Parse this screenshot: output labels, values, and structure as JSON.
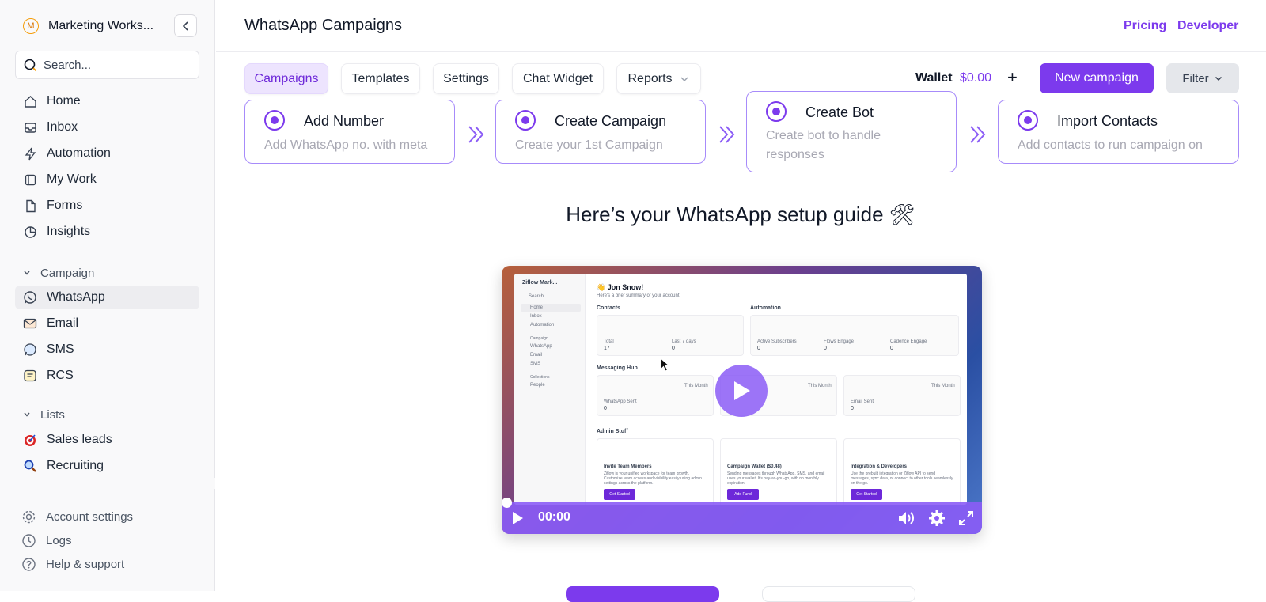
{
  "sidebar": {
    "workspace": {
      "initial": "M",
      "name": "Marketing Works..."
    },
    "search_placeholder": "Search...",
    "nav": [
      {
        "label": "Home",
        "icon": "home-icon"
      },
      {
        "label": "Inbox",
        "icon": "inbox-icon"
      },
      {
        "label": "Automation",
        "icon": "lightning-icon"
      },
      {
        "label": "My Work",
        "icon": "board-icon"
      },
      {
        "label": "Forms",
        "icon": "document-icon"
      },
      {
        "label": "Insights",
        "icon": "pie-chart-icon"
      }
    ],
    "campaign_section": "Campaign",
    "campaign_items": [
      {
        "label": "WhatsApp",
        "icon": "whatsapp-icon",
        "active": true
      },
      {
        "label": "Email",
        "icon": "email-icon"
      },
      {
        "label": "SMS",
        "icon": "sms-icon"
      },
      {
        "label": "RCS",
        "icon": "rcs-icon"
      }
    ],
    "lists_section": "Lists",
    "list_items": [
      {
        "label": "Sales leads",
        "icon": "target-icon"
      },
      {
        "label": "Recruiting",
        "icon": "magnifier-icon"
      }
    ],
    "bottom": [
      {
        "label": "Account settings",
        "icon": "gear-icon"
      },
      {
        "label": "Logs",
        "icon": "clock-icon"
      },
      {
        "label": "Help & support",
        "icon": "help-icon"
      }
    ]
  },
  "header": {
    "title": "WhatsApp Campaigns",
    "pricing": "Pricing",
    "developer": "Developer"
  },
  "tabs": [
    {
      "label": "Campaigns",
      "active": true
    },
    {
      "label": "Templates"
    },
    {
      "label": "Settings"
    },
    {
      "label": "Chat Widget"
    },
    {
      "label": "Reports"
    }
  ],
  "wallet": {
    "label": "Wallet",
    "amount": "$0.00",
    "add": "+"
  },
  "actions": {
    "new_campaign": "New campaign",
    "filter": "Filter"
  },
  "steps": [
    {
      "title": "Add Number",
      "desc": "Add WhatsApp no. with meta"
    },
    {
      "title": "Create Campaign",
      "desc": "Create your 1st Campaign"
    },
    {
      "title": "Create Bot",
      "desc": "Create bot to handle responses"
    },
    {
      "title": "Import Contacts",
      "desc": "Add contacts to run campaign on"
    }
  ],
  "guide": {
    "title": "Here’s your WhatsApp setup guide 🛠",
    "video": {
      "time": "00:00",
      "progress": 0,
      "preview": {
        "ws_name": "Ziflow Mark...",
        "search": "Search...",
        "nav": [
          "Home",
          "Inbox",
          "Automation"
        ],
        "campaign_label": "Campaign",
        "campaign_items": [
          "WhatsApp",
          "Email",
          "SMS"
        ],
        "collections_label": "Collections",
        "collections_items": [
          "People"
        ],
        "greeting": "👋 Jon Snow!",
        "summary": "Here's a brief summary of your account.",
        "contacts": "Contacts",
        "automation": "Automation",
        "total": "Total",
        "total_val": "17",
        "last7": "Last 7 days",
        "last7_val": "0",
        "active_subs": "Active Subscribers",
        "active_subs_val": "0",
        "flows": "Flows Engage",
        "flows_val": "0",
        "cadence": "Cadence Engage",
        "cadence_val": "0",
        "hub": "Messaging Hub",
        "this_month": "This Month",
        "wa_sent": "WhatsApp Sent",
        "wa_sent_val": "0",
        "email_sent": "Email Sent",
        "email_sent_val": "0",
        "admin": "Admin Stuff",
        "invite": "Invite Team Members",
        "invite_desc": "Ziflow is your unified workspace for team growth. Customize team access and visibility easily using admin settings across the platform.",
        "wallet_card": "Campaign Wallet ($0.48)",
        "wallet_desc": "Sending messages through WhatsApp, SMS, and email uses your wallet. It's pay-as-you-go, with no monthly expiration.",
        "integration": "Integration & Developers",
        "integration_desc": "Use the prebuilt integration or Ziflow API to send messages, sync data, or connect to other tools seamlessly on the go.",
        "get_started": "Get Started",
        "add_fund": "Add Fund"
      }
    }
  }
}
